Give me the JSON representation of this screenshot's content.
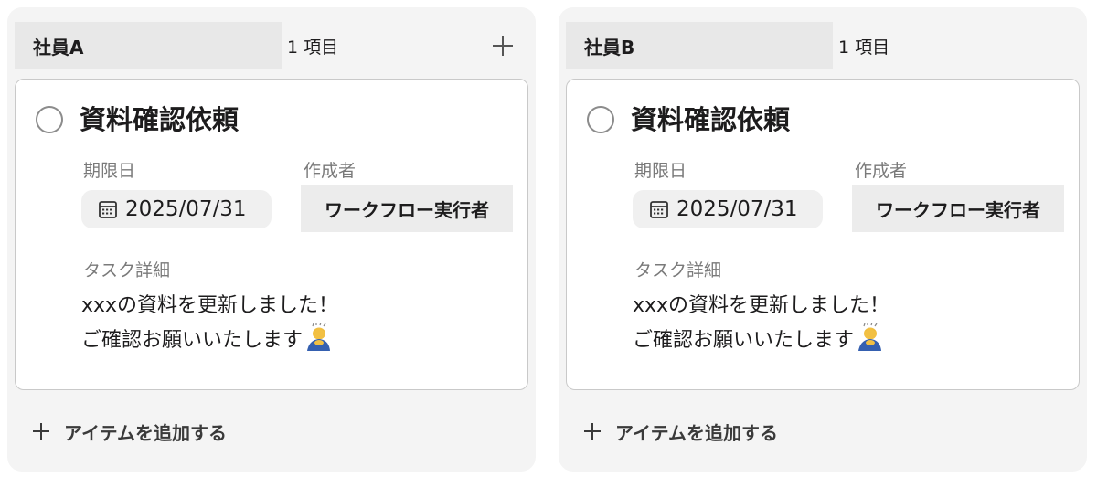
{
  "columns": [
    {
      "group_name": "社員A",
      "item_count": "1 項目",
      "header_add_icon": "plus-icon",
      "card": {
        "title": "資料確認依頼",
        "due_label": "期限日",
        "due_date": "2025/07/31",
        "creator_label": "作成者",
        "creator": "ワークフロー実行者",
        "detail_label": "タスク詳細",
        "detail_line1": "xxxの資料を更新しました！",
        "detail_line2": "ご確認お願いいたします",
        "detail_emoji": "bowing-person-emoji"
      },
      "add_item_label": "アイテムを追加する"
    },
    {
      "group_name": "社員B",
      "item_count": "1 項目",
      "card": {
        "title": "資料確認依頼",
        "due_label": "期限日",
        "due_date": "2025/07/31",
        "creator_label": "作成者",
        "creator": "ワークフロー実行者",
        "detail_label": "タスク詳細",
        "detail_line1": "xxxの資料を更新しました！",
        "detail_line2": "ご確認お願いいたします",
        "detail_emoji": "bowing-person-emoji"
      },
      "add_item_label": "アイテムを追加する"
    }
  ],
  "colors": {
    "column_bg": "#f4f4f4",
    "chip_bg": "#e8e8e8",
    "card_border": "#c9c9c9",
    "label_gray": "#7a7a7a",
    "text": "#1d1c1d"
  }
}
